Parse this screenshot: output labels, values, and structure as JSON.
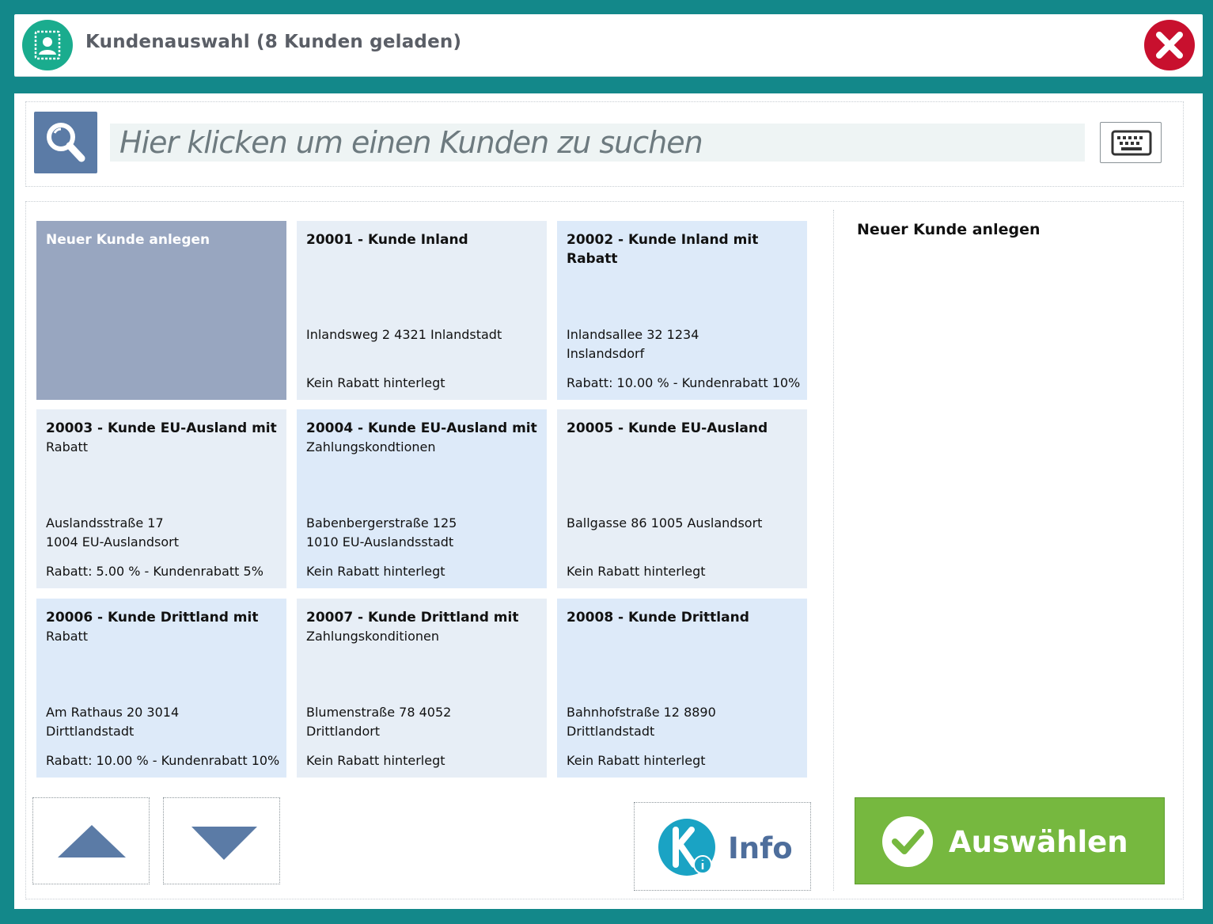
{
  "window": {
    "title": "Kundenauswahl (8 Kunden geladen)",
    "app_icon": "customer-card-icon",
    "close_icon": "close-icon",
    "colors": {
      "frame": "#13888a",
      "app_icon_bg": "#1aac8e",
      "close_bg": "#c8102e"
    }
  },
  "search": {
    "placeholder": "Hier klicken um einen Kunden zu suchen",
    "value": "",
    "search_icon": "search-icon",
    "keyboard_icon": "keyboard-icon"
  },
  "customers": [
    {
      "kind": "new",
      "title": "Neuer Kunde anlegen",
      "title_rest": "",
      "address": "",
      "rabatt": ""
    },
    {
      "kind": "customer",
      "title": "20001 - Kunde Inland",
      "title_rest": "",
      "address": "Inlandsweg 2 4321 Inlandstadt",
      "rabatt": "Kein Rabatt hinterlegt"
    },
    {
      "kind": "customer",
      "title": "20002 - Kunde Inland mit Rabatt",
      "title_rest": "",
      "address": "Inlandsallee 32 1234 Inslandsdorf",
      "rabatt": "Rabatt: 10.00 % - Kundenrabatt 10%"
    },
    {
      "kind": "customer",
      "title": "20003 - Kunde EU-Ausland mit",
      "title_rest": "Rabatt",
      "address": "Auslandsstraße 17 1004 EU-Auslandsort",
      "rabatt": "Rabatt: 5.00 % - Kundenrabatt 5%"
    },
    {
      "kind": "customer",
      "title": "20004 - Kunde EU-Ausland mit",
      "title_rest": "Zahlungskondtionen",
      "address": "Babenbergerstraße 125 1010 EU-Auslandsstadt",
      "rabatt": "Kein Rabatt hinterlegt"
    },
    {
      "kind": "customer",
      "title": "20005 - Kunde EU-Ausland",
      "title_rest": "",
      "address": "Ballgasse 86 1005 Auslandsort",
      "rabatt": "Kein Rabatt hinterlegt"
    },
    {
      "kind": "customer",
      "title": "20006 - Kunde Drittland mit",
      "title_rest": "Rabatt",
      "address": "Am Rathaus 20 3014 Dirttlandstadt",
      "rabatt": "Rabatt: 10.00 % - Kundenrabatt 10%"
    },
    {
      "kind": "customer",
      "title": "20007 - Kunde Drittland mit",
      "title_rest": "Zahlungskonditionen",
      "address": "Blumenstraße 78 4052 Drittlandort",
      "rabatt": "Kein Rabatt hinterlegt"
    },
    {
      "kind": "customer",
      "title": "20008 - Kunde Drittland",
      "title_rest": "",
      "address": "Bahnhofstraße 12 8890 Drittlandstadt",
      "rabatt": "Kein Rabatt hinterlegt"
    }
  ],
  "detail": {
    "title": "Neuer Kunde anlegen"
  },
  "nav": {
    "up_icon": "arrow-up-icon",
    "down_icon": "arrow-down-icon"
  },
  "info": {
    "label": "Info",
    "icon": "k-info-logo-icon"
  },
  "select": {
    "label": "Auswählen",
    "icon": "checkmark-icon",
    "color": "#76b83f"
  }
}
